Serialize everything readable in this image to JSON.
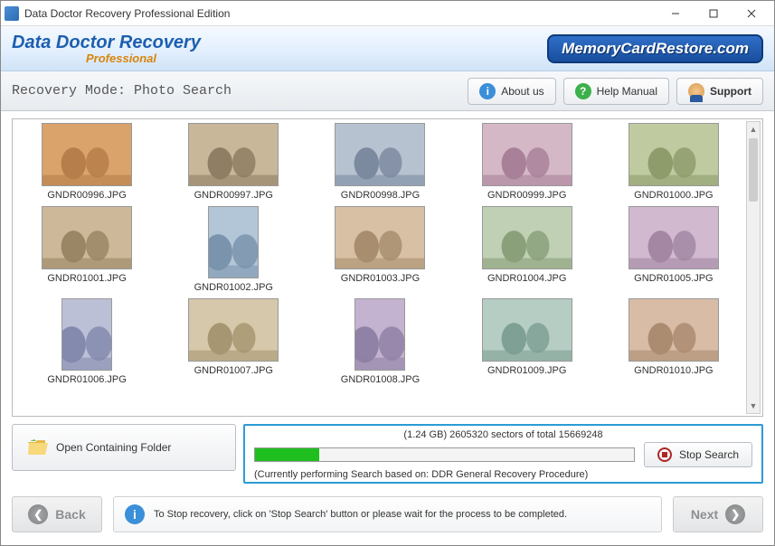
{
  "titlebar": {
    "title": "Data Doctor Recovery Professional Edition"
  },
  "header": {
    "brand_line1": "Data Doctor Recovery",
    "brand_line2": "Professional",
    "site_badge": "MemoryCardRestore.com"
  },
  "toolbar": {
    "mode_label": "Recovery Mode: Photo Search",
    "about_label": "About us",
    "help_label": "Help Manual",
    "support_label": "Support"
  },
  "gallery": {
    "items": [
      {
        "name": "GNDR00996.JPG",
        "orient": "landscape"
      },
      {
        "name": "GNDR00997.JPG",
        "orient": "landscape"
      },
      {
        "name": "GNDR00998.JPG",
        "orient": "landscape"
      },
      {
        "name": "GNDR00999.JPG",
        "orient": "landscape"
      },
      {
        "name": "GNDR01000.JPG",
        "orient": "landscape"
      },
      {
        "name": "GNDR01001.JPG",
        "orient": "landscape"
      },
      {
        "name": "GNDR01002.JPG",
        "orient": "portrait"
      },
      {
        "name": "GNDR01003.JPG",
        "orient": "landscape"
      },
      {
        "name": "GNDR01004.JPG",
        "orient": "landscape"
      },
      {
        "name": "GNDR01005.JPG",
        "orient": "landscape"
      },
      {
        "name": "GNDR01006.JPG",
        "orient": "portrait"
      },
      {
        "name": "GNDR01007.JPG",
        "orient": "landscape"
      },
      {
        "name": "GNDR01008.JPG",
        "orient": "portrait"
      },
      {
        "name": "GNDR01009.JPG",
        "orient": "landscape"
      },
      {
        "name": "GNDR01010.JPG",
        "orient": "landscape"
      }
    ]
  },
  "actions": {
    "open_folder_label": "Open Containing Folder",
    "stop_search_label": "Stop Search"
  },
  "progress": {
    "sectors_text": "(1.24 GB) 2605320  sectors  of  total 15669248",
    "procedure_text": "(Currently performing Search based on:  DDR General Recovery Procedure)",
    "percent": 17
  },
  "footer": {
    "back_label": "Back",
    "next_label": "Next",
    "hint_text": "To Stop recovery, click on 'Stop Search' button or please wait for the process to be completed."
  }
}
